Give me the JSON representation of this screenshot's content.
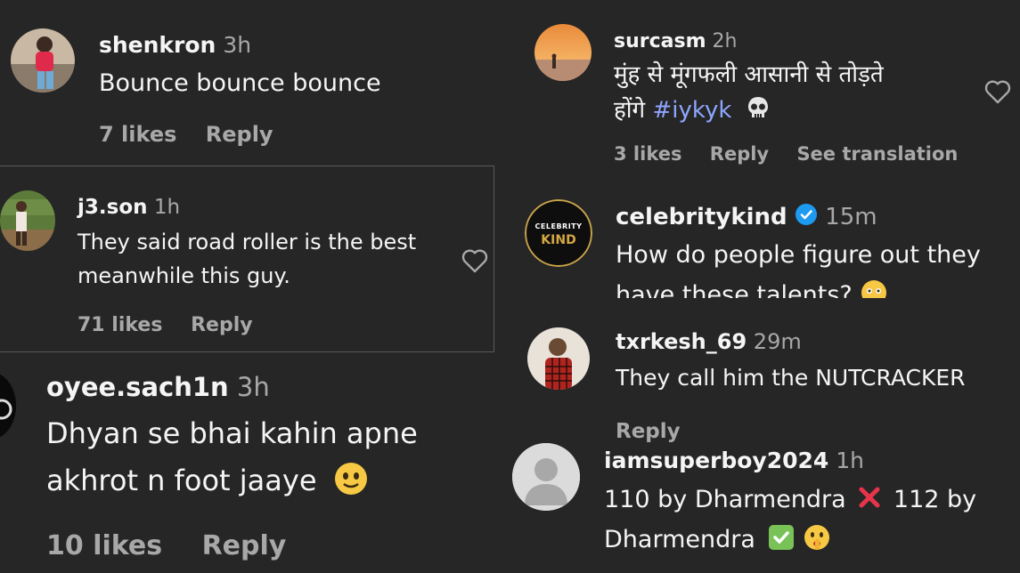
{
  "comments": [
    {
      "username": "shenkron",
      "time": "3h",
      "text": "Bounce bounce bounce",
      "likes": "7 likes",
      "reply": "Reply"
    },
    {
      "username": "j3.son",
      "time": "1h",
      "line1": "They said road roller is the best",
      "line2": "meanwhile this guy.",
      "likes": "71 likes",
      "reply": "Reply"
    },
    {
      "username": "oyee.sach1n",
      "time": "3h",
      "line1": "Dhyan se bhai kahin apne",
      "line2": "akhrot n foot jaaye",
      "likes": "10 likes",
      "reply": "Reply"
    },
    {
      "username": "surcasm",
      "time": "2h",
      "line1": "मुंह से मूंगफली आसानी से तोड़ते",
      "line2_prefix": "होंगे ",
      "hashtag": "#iykyk",
      "likes": "3 likes",
      "reply": "Reply",
      "translate": "See translation"
    },
    {
      "username": "celebritykind",
      "time": "15m",
      "line1": "How do people figure out they",
      "line2": "have these talents?",
      "avatar_text1": "CELEBRITY",
      "avatar_text2": "KIND"
    },
    {
      "username": "txrkesh_69",
      "time": "29m",
      "text": "They call him the NUTCRACKER",
      "reply": "Reply"
    },
    {
      "username": "iamsuperboy2024",
      "time": "1h",
      "line1a": "110 by Dharmendra",
      "line1b": "112 by",
      "line2": "Dharmendra"
    }
  ],
  "colors": {
    "background": "#262626",
    "text": "#f5f5f5",
    "muted": "#a8a8a8",
    "hashtag": "#8ea6ff",
    "verified": "#1d9bf0"
  }
}
